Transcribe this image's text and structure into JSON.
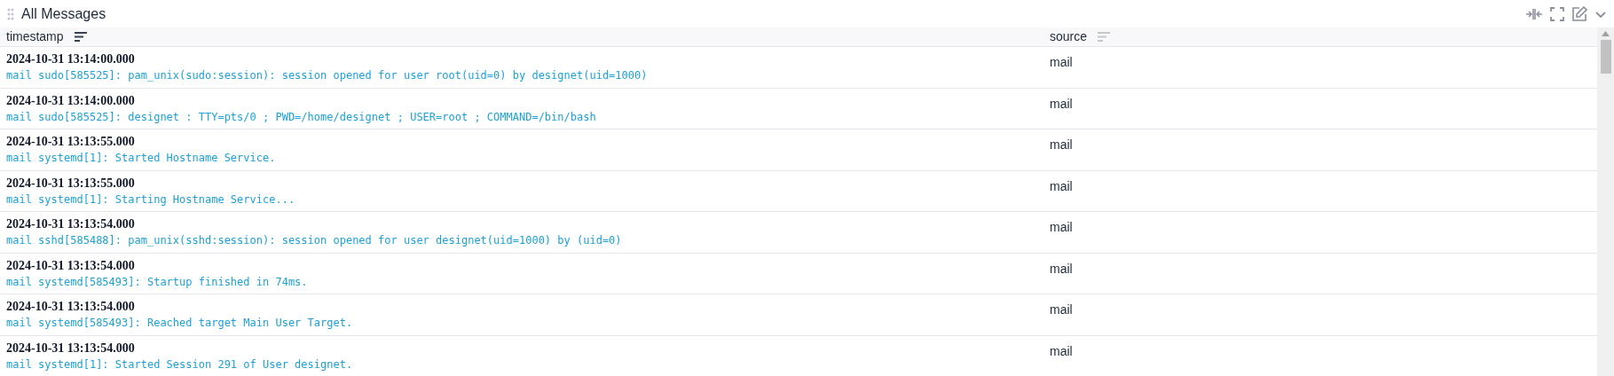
{
  "panel": {
    "title": "All Messages"
  },
  "table": {
    "columns": [
      {
        "label": "timestamp",
        "sorted": true
      },
      {
        "label": "source",
        "sorted": false
      }
    ],
    "rows": [
      {
        "timestamp": "2024-10-31 13:14:00.000",
        "message": "mail sudo[585525]: pam_unix(sudo:session): session opened for user root(uid=0) by designet(uid=1000)",
        "source": "mail"
      },
      {
        "timestamp": "2024-10-31 13:14:00.000",
        "message": "mail sudo[585525]: designet : TTY=pts/0 ; PWD=/home/designet ; USER=root ; COMMAND=/bin/bash",
        "source": "mail"
      },
      {
        "timestamp": "2024-10-31 13:13:55.000",
        "message": "mail systemd[1]: Started Hostname Service.",
        "source": "mail"
      },
      {
        "timestamp": "2024-10-31 13:13:55.000",
        "message": "mail systemd[1]: Starting Hostname Service...",
        "source": "mail"
      },
      {
        "timestamp": "2024-10-31 13:13:54.000",
        "message": "mail sshd[585488]: pam_unix(sshd:session): session opened for user designet(uid=1000) by (uid=0)",
        "source": "mail"
      },
      {
        "timestamp": "2024-10-31 13:13:54.000",
        "message": "mail systemd[585493]: Startup finished in 74ms.",
        "source": "mail"
      },
      {
        "timestamp": "2024-10-31 13:13:54.000",
        "message": "mail systemd[585493]: Reached target Main User Target.",
        "source": "mail"
      },
      {
        "timestamp": "2024-10-31 13:13:54.000",
        "message": "mail systemd[1]: Started Session 291 of User designet.",
        "source": "mail"
      }
    ]
  }
}
